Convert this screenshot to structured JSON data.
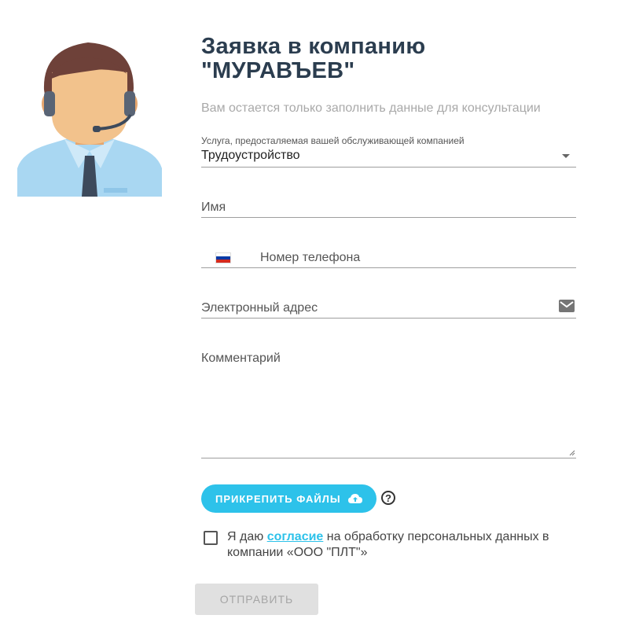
{
  "form": {
    "title_line1": "Заявка в компанию",
    "title_line2": "\"МУРАВЪЕВ\"",
    "subtitle": "Вам остается только заполнить данные для консультации",
    "service_label": "Услуга, предосталяемая вашей обслуживающей компанией",
    "service_value": "Трудоустройство",
    "name_placeholder": "Имя",
    "phone_placeholder": "Номер телефона",
    "email_placeholder": "Электронный адрес",
    "comment_placeholder": "Комментарий",
    "attach_label": "ПРИКРЕПИТЬ ФАЙЛЫ",
    "help_label": "?",
    "consent_before": "Я даю ",
    "consent_link": "согласие",
    "consent_after": " на обработку персональных данных в компании «ООО \"ПЛТ\"»",
    "submit_label": "ОТПРАВИТЬ"
  },
  "colors": {
    "accent": "#2dc2ea",
    "title": "#2b3d4f",
    "submit_bg": "#e0e0e0"
  },
  "icons": [
    "operator-avatar",
    "dropdown-caret-icon",
    "russia-flag-icon",
    "mail-icon",
    "cloud-upload-icon",
    "help-icon",
    "resize-handle-icon"
  ]
}
